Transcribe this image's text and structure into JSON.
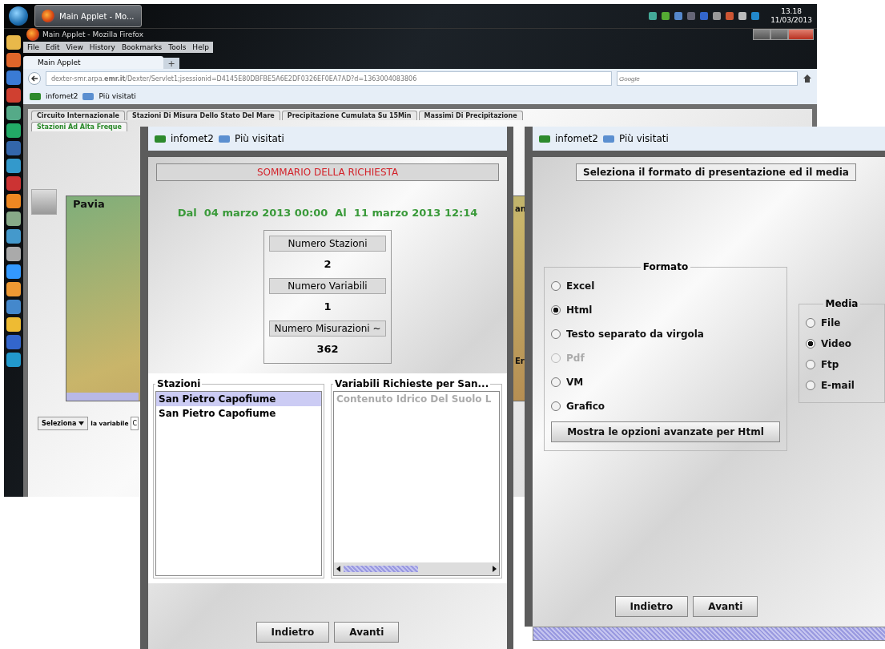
{
  "taskbar": {
    "task": "Main Applet - Mo...",
    "clock_time": "13.18",
    "clock_date": "11/03/2013"
  },
  "browser": {
    "title": "Main Applet - Mozilla Firefox",
    "menu": [
      "File",
      "Edit",
      "View",
      "History",
      "Bookmarks",
      "Tools",
      "Help"
    ],
    "tab": "Main Applet",
    "new_tab": "+",
    "url": "dexter-smr.arpa.**emr.it**/Dexter/Servlet1;jsessionid=D4145E80DBFBE5A6E2DF0326EF0EA7AD?d=1363004083806",
    "search": {
      "placeholder": "Google"
    },
    "bookmarks": [
      "infomet2",
      "Più visitati"
    ]
  },
  "applet": {
    "tabs": [
      {
        "label": "Circuito Internazionale",
        "selected": false
      },
      {
        "label": "Stazioni Di Misura Dello Stato Del Mare",
        "selected": false
      },
      {
        "label": "Precipitazione Cumulata Su 15Min",
        "selected": false
      },
      {
        "label": "Massimi Di Precipitazione",
        "selected": false
      },
      {
        "label": "Stazioni Ad Alta Freque",
        "selected": true
      }
    ],
    "map_labels": [
      "Pavia",
      "an",
      "Er"
    ],
    "select": "Seleziona",
    "variable_label": "la variabile",
    "variable_value": "C"
  },
  "summary_window": {
    "bookmarks": [
      "infomet2",
      "Più visitati"
    ],
    "title": "SOMMARIO DELLA RICHIESTA",
    "period": "Dal  04 marzo 2013 00:00  Al  11 marzo 2013 12:14",
    "stats": [
      {
        "label": "Numero Stazioni",
        "value": "2"
      },
      {
        "label": "Numero Variabili",
        "value": "1"
      },
      {
        "label": "Numero Misurazioni ~",
        "value": "362"
      }
    ],
    "stations": {
      "heading": "Stazioni",
      "items": [
        {
          "label": "San Pietro Capofiume",
          "selected": true
        },
        {
          "label": "San Pietro Capofiume",
          "selected": false
        }
      ]
    },
    "variables": {
      "heading": "Variabili Richieste per San...",
      "items": [
        {
          "label": "Contenuto Idrico Del Suolo L",
          "disabled": true
        }
      ]
    },
    "buttons": [
      "Indietro",
      "Avanti"
    ]
  },
  "format_window": {
    "bookmarks": [
      "infomet2",
      "Più visitati"
    ],
    "title": "Seleziona il formato di presentazione ed il media",
    "format": {
      "legend": "Formato",
      "options": [
        {
          "label": "Excel",
          "selected": false,
          "disabled": false
        },
        {
          "label": "Html",
          "selected": true,
          "disabled": false
        },
        {
          "label": "Testo separato da virgola",
          "selected": false,
          "disabled": false
        },
        {
          "label": "Pdf",
          "selected": false,
          "disabled": true
        },
        {
          "label": "VM",
          "selected": false,
          "disabled": false
        },
        {
          "label": "Grafico",
          "selected": false,
          "disabled": false
        }
      ],
      "advanced_button": "Mostra le opzioni avanzate per Html"
    },
    "media": {
      "legend": "Media",
      "options": [
        {
          "label": "File",
          "selected": false,
          "disabled": false
        },
        {
          "label": "Video",
          "selected": true,
          "disabled": false
        },
        {
          "label": "Ftp",
          "selected": false,
          "disabled": false
        },
        {
          "label": "E-mail",
          "selected": false,
          "disabled": false
        }
      ]
    },
    "buttons": [
      "Indietro",
      "Avanti"
    ]
  }
}
